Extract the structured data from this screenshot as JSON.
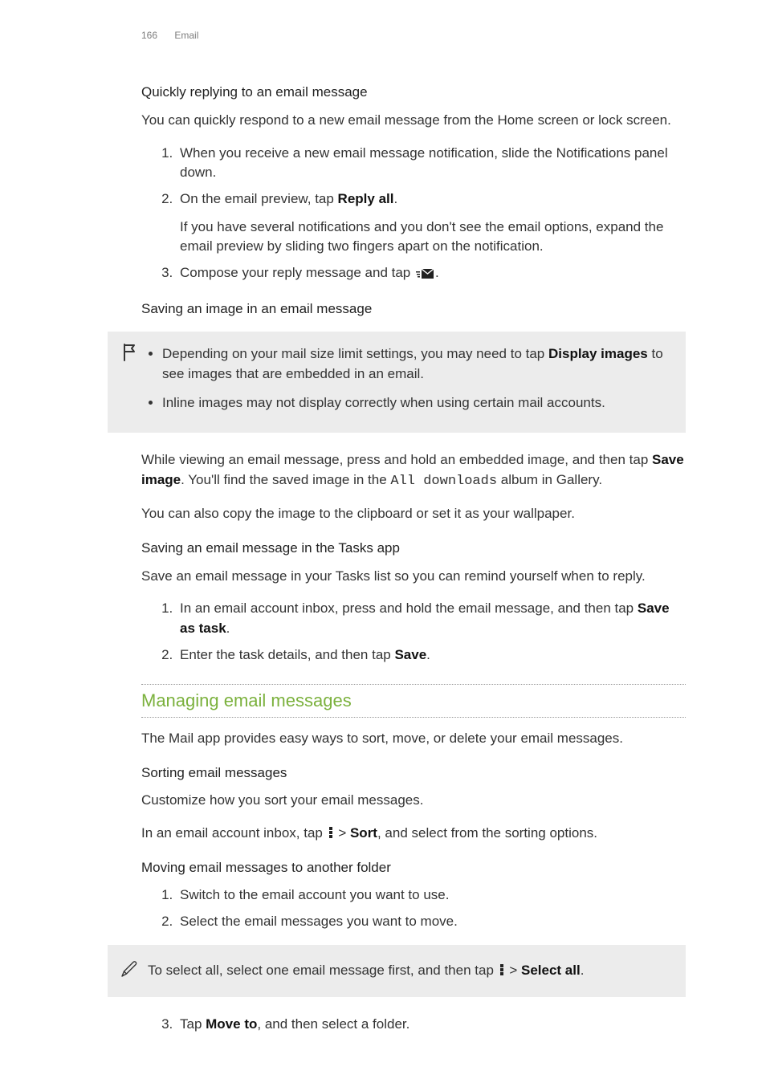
{
  "header": {
    "page_number": "166",
    "section": "Email"
  },
  "quick_reply": {
    "heading": "Quickly replying to an email message",
    "intro": "You can quickly respond to a new email message from the Home screen or lock screen.",
    "steps": {
      "s1": "When you receive a new email message notification, slide the Notifications panel down.",
      "s2_pre": "On the email preview, tap ",
      "s2_bold": "Reply all",
      "s2_post": ".",
      "s2_note": "If you have several notifications and you don't see the email options, expand the email preview by sliding two fingers apart on the notification.",
      "s3_pre": "Compose your reply message and tap ",
      "s3_post": "."
    }
  },
  "save_image": {
    "heading": "Saving an image in an email message",
    "note1_pre": "Depending on your mail size limit settings, you may need to tap ",
    "note1_bold": "Display images",
    "note1_post": " to see images that are embedded in an email.",
    "note2": "Inline images may not display correctly when using certain mail accounts.",
    "p1_pre": "While viewing an email message, press and hold an embedded image, and then tap ",
    "p1_bold": "Save image",
    "p1_mid": ". You'll find the saved image in the ",
    "p1_mono": "All downloads",
    "p1_post": " album in Gallery.",
    "p2": "You can also copy the image to the clipboard or set it as your wallpaper."
  },
  "save_task": {
    "heading": "Saving an email message in the Tasks app",
    "intro": "Save an email message in your Tasks list so you can remind yourself when to reply.",
    "s1_pre": "In an email account inbox, press and hold the email message, and then tap ",
    "s1_bold": "Save as task",
    "s1_post": ".",
    "s2_pre": "Enter the task details, and then tap ",
    "s2_bold": "Save",
    "s2_post": "."
  },
  "managing": {
    "title": "Managing email messages",
    "intro": "The Mail app provides easy ways to sort, move, or delete your email messages.",
    "sorting": {
      "heading": "Sorting email messages",
      "p1": "Customize how you sort your email messages.",
      "p2_pre": "In an email account inbox, tap ",
      "p2_mid": " > ",
      "p2_bold": "Sort",
      "p2_post": ", and select from the sorting options."
    },
    "moving": {
      "heading": "Moving email messages to another folder",
      "s1": "Switch to the email account you want to use.",
      "s2": "Select the email messages you want to move.",
      "tip_pre": "To select all, select one email message first, and then tap ",
      "tip_mid": " > ",
      "tip_bold": "Select all",
      "tip_post": ".",
      "s3_pre": "Tap ",
      "s3_bold": "Move to",
      "s3_post": ", and then select a folder."
    }
  }
}
